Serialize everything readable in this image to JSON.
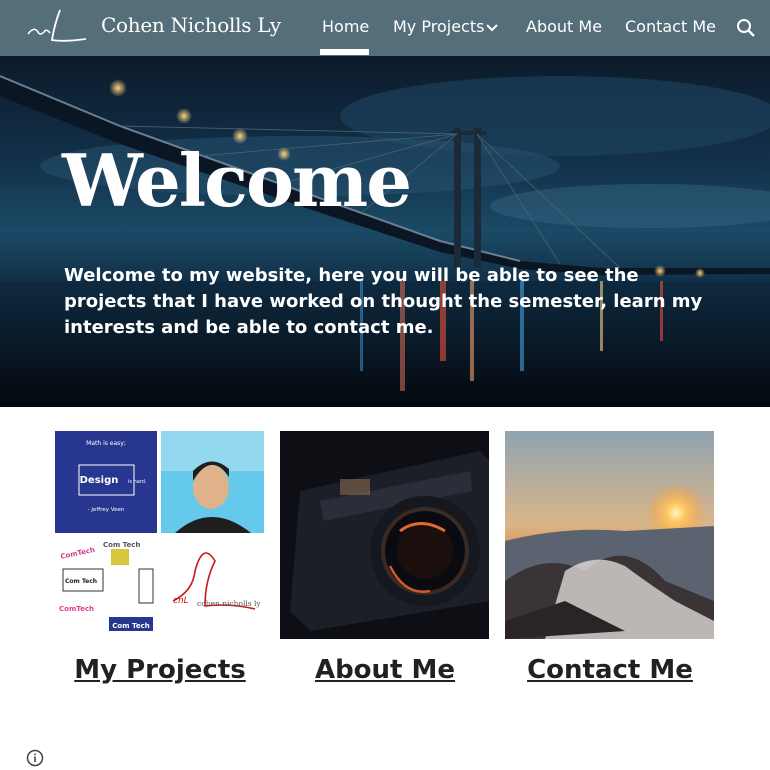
{
  "header": {
    "site_title": "Cohen Nicholls Ly",
    "logo_text": "cnL",
    "nav": {
      "home": "Home",
      "projects": "My Projects",
      "about": "About Me",
      "contact": "Contact Me"
    },
    "active_tab": "Home",
    "background_color": "#546e7a"
  },
  "hero": {
    "title": "Welcome",
    "text": "Welcome to my website, here you will be able to see the projects that I have worked on thought the semester, learn my interests and be able to contact me."
  },
  "cards": {
    "projects": {
      "label": "My Projects",
      "collage": {
        "math_caption": "Math is easy;",
        "design_word": "Design",
        "design_suffix": "is hard.",
        "quote_author": "- Jeffrey Veen",
        "comtech_a": "ComTech",
        "comtech_b": "Com Tech",
        "comtech_c": "Com Tech",
        "comtech_d": "ComTech",
        "comtech_e": "Com Tech",
        "logo_name": "cohen nicholls ly"
      }
    },
    "about": {
      "label": "About Me"
    },
    "contact": {
      "label": "Contact Me"
    }
  },
  "icons": {
    "search": "search-icon",
    "chevron": "chevron-down-icon",
    "info": "info-icon"
  }
}
